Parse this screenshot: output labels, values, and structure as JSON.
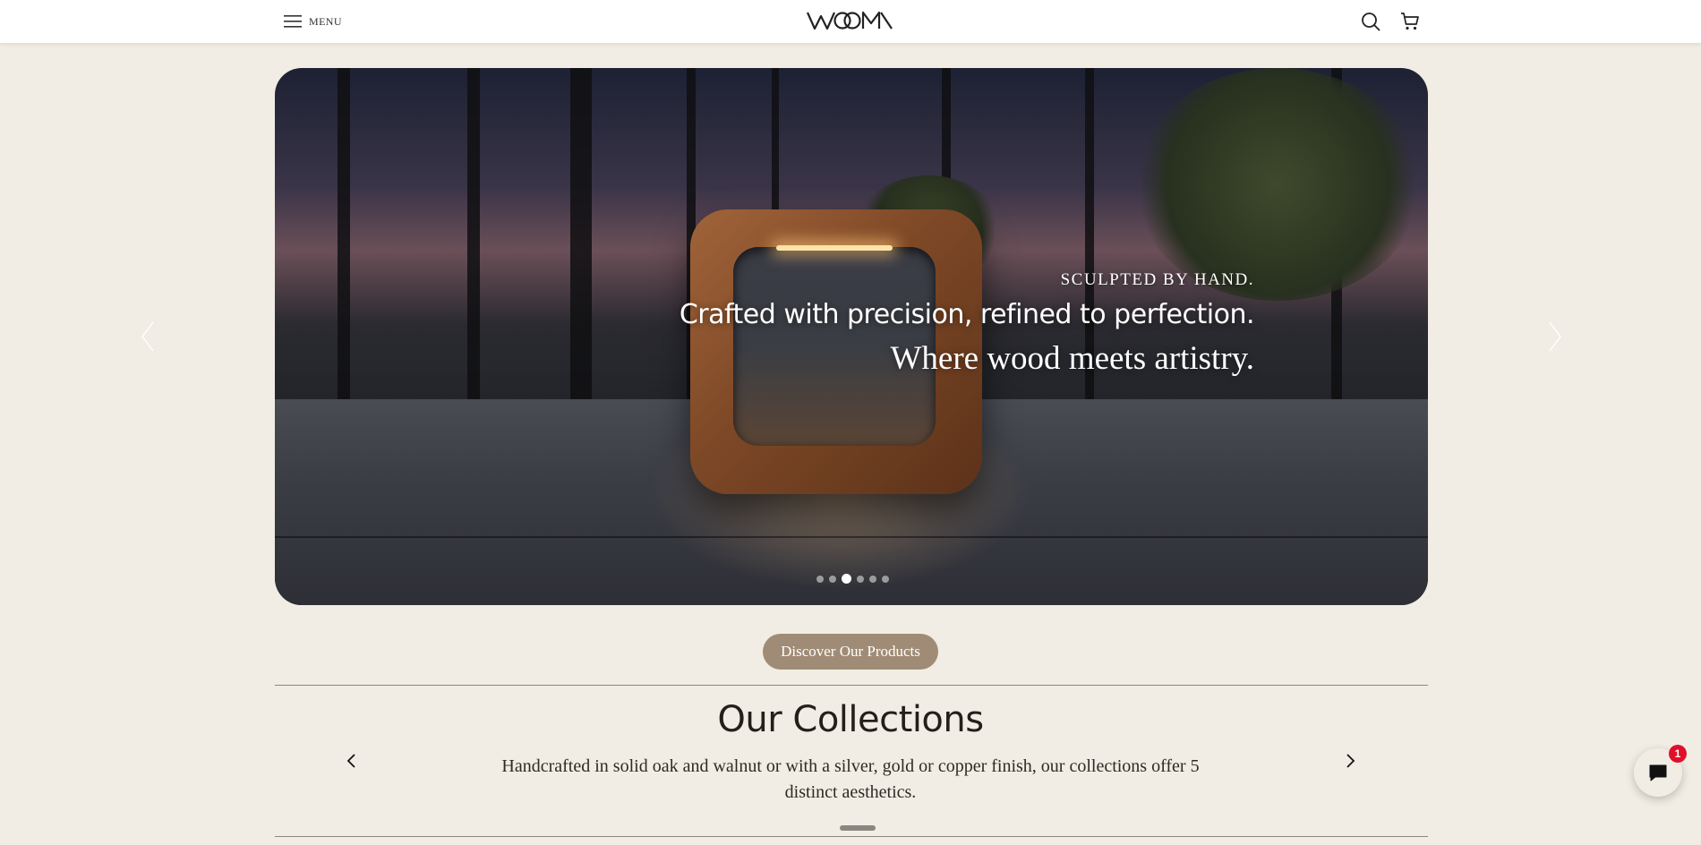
{
  "header": {
    "menu_label": "MENU",
    "logo_text": "WOOM",
    "icons": [
      "hamburger-icon",
      "search-icon",
      "cart-icon"
    ]
  },
  "hero": {
    "eyebrow": "SCULPTED BY HAND.",
    "headline": "Crafted with precision, refined to perfection.",
    "tagline": "Where wood meets artistry.",
    "slides_total": 6,
    "active_slide": 3
  },
  "cta": {
    "label": "Discover Our Products",
    "color": "#a08c76"
  },
  "collections": {
    "title": "Our Collections",
    "description": "Handcrafted in solid oak and walnut or with a silver, gold or copper finish, our collections offer 5 distinct aesthetics."
  },
  "chat": {
    "badge_count": "1",
    "badge_color": "#e0102a"
  },
  "colors": {
    "background": "#f1ede4",
    "header": "#ffffff"
  }
}
